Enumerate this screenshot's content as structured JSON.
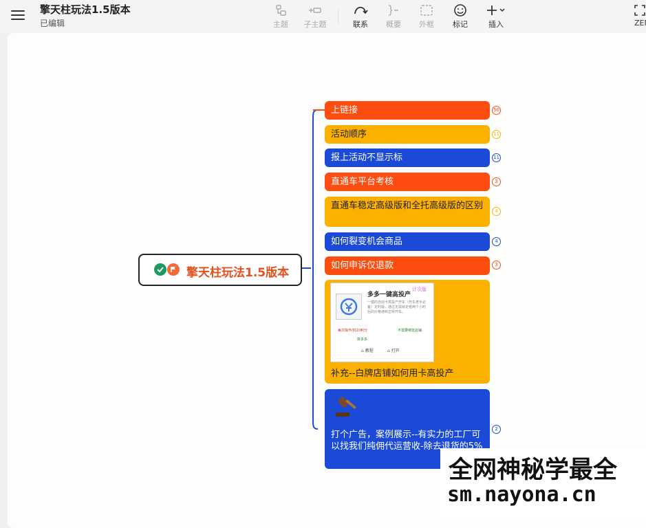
{
  "header": {
    "title": "擎天柱玩法1.5版本",
    "status": "已编辑"
  },
  "toolbar": {
    "topic": "主题",
    "subtopic": "子主题",
    "relation": "联系",
    "summary": "概要",
    "boundary": "外框",
    "marker": "标记",
    "insert": "插入",
    "zen": "ZEN"
  },
  "mindmap": {
    "root": "擎天柱玩法1.5版本",
    "branches": [
      {
        "label": "上链接",
        "count": "50"
      },
      {
        "label": "活动顺序",
        "count": "11"
      },
      {
        "label": "报上活动不显示标",
        "count": "11"
      },
      {
        "label": "直通车平台考核",
        "count": "3"
      },
      {
        "label": "直通车稳定高级版和全托高级版的区别",
        "count": "4"
      },
      {
        "label": "如何裂变机会商品",
        "count": "4"
      },
      {
        "label": "如何申诉仅退款",
        "count": "3"
      },
      {
        "label": "补充--白牌店铺如何用卡高投产"
      },
      {
        "label": "打个广告，案例展示--有实力的工厂可以找我们纯佣代运营收-除去退货的5%",
        "count": "2"
      }
    ],
    "card": {
      "title": "多多一键高投产",
      "tag": "计次版",
      "desc": "一键的自动卡高投产开车（开车老手必备）定时版，通过无需锁定者两个小时后的价格通到正常开车。",
      "left": "每次操作/扣20积分",
      "right": "不需要绑定店铺",
      "mid": "拼多多",
      "btn1": "教程",
      "btn2": "打开"
    }
  },
  "watermark": {
    "line1": "全网神秘学最全",
    "line2": "sm.nayona.cn"
  },
  "colors": {
    "red": "#fd4d10",
    "yellow": "#fcb100",
    "blue": "#1b4bd6",
    "root_text": "#e4501e"
  }
}
